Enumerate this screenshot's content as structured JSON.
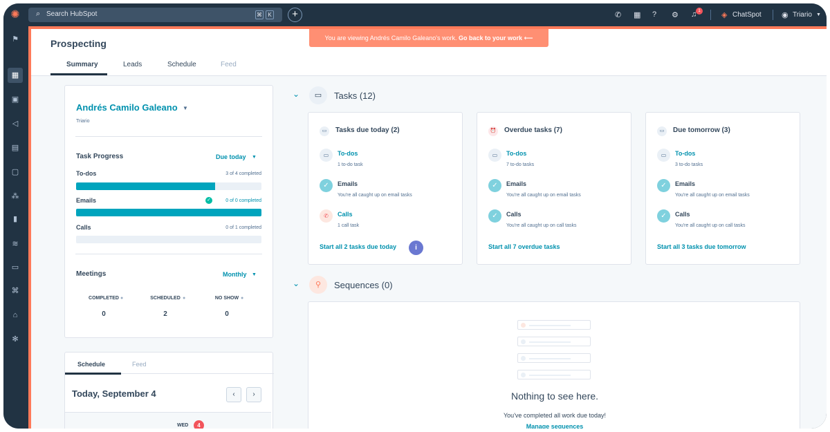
{
  "topbar": {
    "search_placeholder": "Search HubSpot",
    "shortcut_keys": [
      "⌘",
      "K"
    ],
    "notification_count": "1",
    "chatspot_label": "ChatSpot",
    "account_name": "Triario"
  },
  "banner": {
    "text": "You are viewing Andrés Camilo Galeano's work.",
    "link": "Go back to your work ⟵"
  },
  "header": {
    "title": "Prospecting",
    "tabs": [
      {
        "label": "Summary",
        "active": true
      },
      {
        "label": "Leads"
      },
      {
        "label": "Schedule"
      },
      {
        "label": "Feed",
        "disabled": true
      }
    ]
  },
  "profile": {
    "name": "Andrés Camilo Galeano",
    "company": "Triario",
    "task_progress": {
      "title": "Task Progress",
      "filter": "Due today",
      "rows": [
        {
          "label": "To-dos",
          "count": "3 of 4 completed",
          "fraction": 0.75
        },
        {
          "label": "Emails",
          "count": "0 of 0 completed",
          "fraction": 1.0
        },
        {
          "label": "Calls",
          "count": "0 of 1 completed",
          "fraction": 0.0
        }
      ]
    },
    "meetings": {
      "title": "Meetings",
      "filter": "Monthly",
      "stats": [
        {
          "label": "COMPLETED",
          "value": "0"
        },
        {
          "label": "SCHEDULED",
          "value": "2"
        },
        {
          "label": "NO SHOW",
          "value": "0"
        }
      ]
    }
  },
  "schedule": {
    "tabs": [
      "Schedule",
      "Feed"
    ],
    "date_heading": "Today, September 4",
    "day_label": "WED",
    "day_number": "4"
  },
  "tasks": {
    "heading": "Tasks (12)",
    "cards": [
      {
        "title": "Tasks due today (2)",
        "rows": [
          {
            "title": "To-dos",
            "sub": "1 to-do task",
            "link": true
          },
          {
            "title": "Emails",
            "sub": "You're all caught up on email tasks"
          },
          {
            "title": "Calls",
            "sub": "1 call task",
            "link": true
          }
        ],
        "action": "Start all 2 tasks due today"
      },
      {
        "title": "Overdue tasks (7)",
        "rows": [
          {
            "title": "To-dos",
            "sub": "7 to-do tasks",
            "link": true
          },
          {
            "title": "Emails",
            "sub": "You're all caught up on email tasks"
          },
          {
            "title": "Calls",
            "sub": "You're all caught up on call tasks"
          }
        ],
        "action": "Start all 7 overdue tasks"
      },
      {
        "title": "Due tomorrow (3)",
        "rows": [
          {
            "title": "To-dos",
            "sub": "3 to-do tasks",
            "link": true
          },
          {
            "title": "Emails",
            "sub": "You're all caught up on email tasks"
          },
          {
            "title": "Calls",
            "sub": "You're all caught up on call tasks"
          }
        ],
        "action": "Start all 3 tasks due tomorrow"
      }
    ]
  },
  "sequences": {
    "heading": "Sequences (0)",
    "empty_title": "Nothing to see here.",
    "empty_sub": "You've completed all work due today!",
    "empty_link": "Manage sequences"
  }
}
